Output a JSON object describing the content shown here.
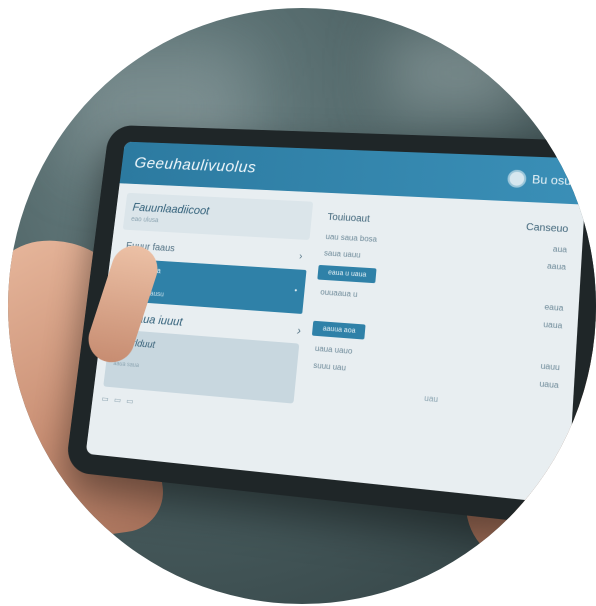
{
  "app": {
    "title": "Geeuhaulivuolus",
    "user_label": "Bu osu"
  },
  "left": {
    "card1": {
      "title": "Fauunlaadiicoot",
      "sub": "eao ulusa"
    },
    "row1": {
      "label": "Euuur faaus",
      "chevron": "›"
    },
    "selected": {
      "l1": "ulua aauaa",
      "l2a": "euuoa",
      "l2b": "•",
      "l3": "uoa bus uausu"
    },
    "section": {
      "title": "Saugaua iuuut",
      "chevron": "›"
    },
    "light_card": {
      "title": "Eaurlduut",
      "sub": "aaua saua"
    },
    "icons": [
      "▭",
      "▭",
      "▭"
    ]
  },
  "right": {
    "head": {
      "left": "Touiuoaut",
      "right": "Canseuo"
    },
    "lines": [
      {
        "left": "uau saua bosa",
        "right": "aua"
      },
      {
        "left": "saua uauu",
        "right": "aaua"
      }
    ],
    "pill1": "eaua u uaua",
    "lines2": [
      {
        "left": "ouuaaua u",
        "right": "eaua"
      },
      {
        "left": "",
        "right": "uaua"
      }
    ],
    "pill2": "aauua aoa",
    "lines3": [
      {
        "left": "uaua uauo",
        "right": "uauu"
      },
      {
        "left": "suuu uau",
        "right": "uaua"
      }
    ],
    "bottom": "uau"
  }
}
